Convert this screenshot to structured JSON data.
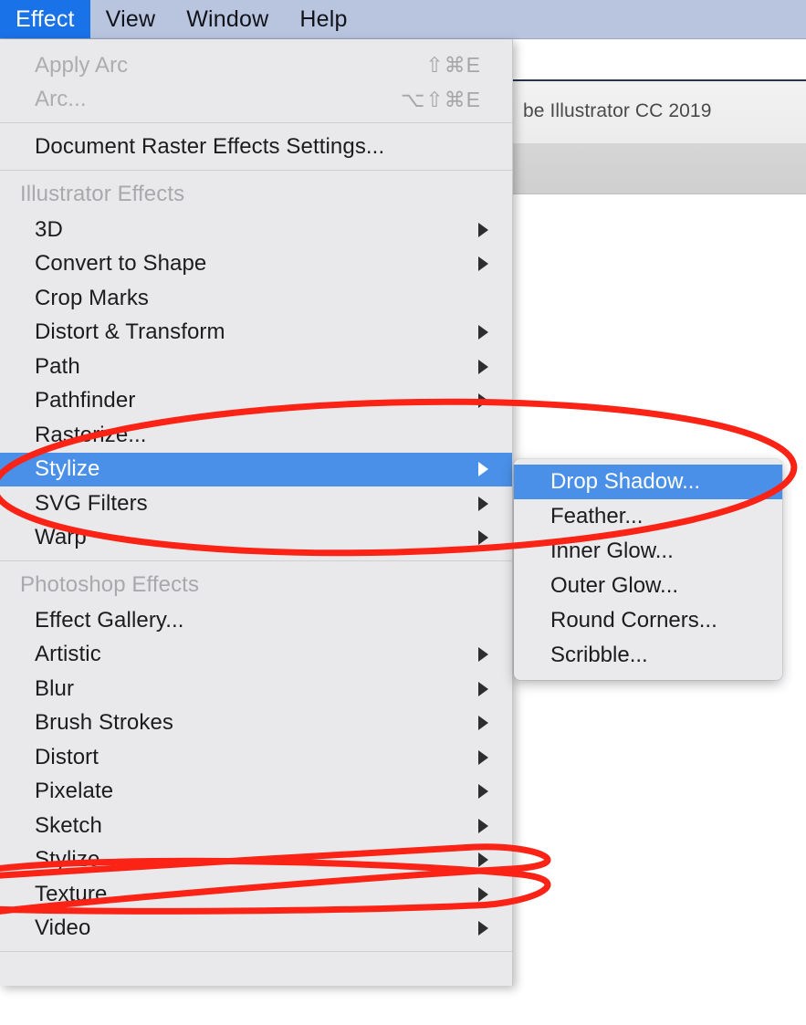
{
  "colors": {
    "menubar_bg": "#b9c5df",
    "menubar_active_bg": "#1a72e8",
    "menu_bg": "#e9e9eb",
    "menu_highlight_bg": "#4a90e8",
    "menu_text": "#1c1c1e",
    "menu_disabled_text": "#adadb0",
    "menu_section_text": "#a9a9ad",
    "annotation_red": "#fb2316",
    "app_toolbar_band": "#d2d2d2"
  },
  "menubar": {
    "items": [
      {
        "label": "Effect",
        "active": true
      },
      {
        "label": "View",
        "active": false
      },
      {
        "label": "Window",
        "active": false
      },
      {
        "label": "Help",
        "active": false
      }
    ]
  },
  "background_app": {
    "title": "be Illustrator CC 2019"
  },
  "effect_menu": {
    "groups": [
      {
        "id": "apply-group",
        "items": [
          {
            "label": "Apply Arc",
            "shortcut": "⇧⌘E",
            "disabled": true,
            "submenu": false
          },
          {
            "label": "Arc...",
            "shortcut": "⌥⇧⌘E",
            "disabled": true,
            "submenu": false
          }
        ]
      },
      {
        "id": "raster-settings-group",
        "items": [
          {
            "label": "Document Raster Effects Settings...",
            "shortcut": "",
            "disabled": false,
            "submenu": false
          }
        ]
      },
      {
        "id": "illustrator-effects-group",
        "section_label": "Illustrator Effects",
        "items": [
          {
            "label": "3D",
            "shortcut": "",
            "disabled": false,
            "submenu": true
          },
          {
            "label": "Convert to Shape",
            "shortcut": "",
            "disabled": false,
            "submenu": true
          },
          {
            "label": "Crop Marks",
            "shortcut": "",
            "disabled": false,
            "submenu": false
          },
          {
            "label": "Distort & Transform",
            "shortcut": "",
            "disabled": false,
            "submenu": true
          },
          {
            "label": "Path",
            "shortcut": "",
            "disabled": false,
            "submenu": true
          },
          {
            "label": "Pathfinder",
            "shortcut": "",
            "disabled": false,
            "submenu": true
          },
          {
            "label": "Rasterize...",
            "shortcut": "",
            "disabled": false,
            "submenu": false
          },
          {
            "label": "Stylize",
            "shortcut": "",
            "disabled": false,
            "submenu": true,
            "selected": true
          },
          {
            "label": "SVG Filters",
            "shortcut": "",
            "disabled": false,
            "submenu": true
          },
          {
            "label": "Warp",
            "shortcut": "",
            "disabled": false,
            "submenu": true
          }
        ]
      },
      {
        "id": "photoshop-effects-group",
        "section_label": "Photoshop Effects",
        "items": [
          {
            "label": "Effect Gallery...",
            "shortcut": "",
            "disabled": false,
            "submenu": false
          },
          {
            "label": "Artistic",
            "shortcut": "",
            "disabled": false,
            "submenu": true
          },
          {
            "label": "Blur",
            "shortcut": "",
            "disabled": false,
            "submenu": true
          },
          {
            "label": "Brush Strokes",
            "shortcut": "",
            "disabled": false,
            "submenu": true
          },
          {
            "label": "Distort",
            "shortcut": "",
            "disabled": false,
            "submenu": true
          },
          {
            "label": "Pixelate",
            "shortcut": "",
            "disabled": false,
            "submenu": true
          },
          {
            "label": "Sketch",
            "shortcut": "",
            "disabled": false,
            "submenu": true
          },
          {
            "label": "Stylize",
            "shortcut": "",
            "disabled": false,
            "submenu": true,
            "crossed_out": true
          },
          {
            "label": "Texture",
            "shortcut": "",
            "disabled": false,
            "submenu": true
          },
          {
            "label": "Video",
            "shortcut": "",
            "disabled": false,
            "submenu": true
          }
        ]
      }
    ]
  },
  "stylize_submenu": {
    "items": [
      {
        "label": "Drop Shadow...",
        "selected": true
      },
      {
        "label": "Feather...",
        "selected": false
      },
      {
        "label": "Inner Glow...",
        "selected": false
      },
      {
        "label": "Outer Glow...",
        "selected": false
      },
      {
        "label": "Round Corners...",
        "selected": false
      },
      {
        "label": "Scribble...",
        "selected": false
      }
    ]
  },
  "annotations": [
    {
      "kind": "ellipse-highlight",
      "target": "Stylize / Drop Shadow...",
      "color": "#fb2316"
    },
    {
      "kind": "scribble-strikeout",
      "target": "Photoshop Effects > Stylize",
      "color": "#fb2316"
    }
  ]
}
